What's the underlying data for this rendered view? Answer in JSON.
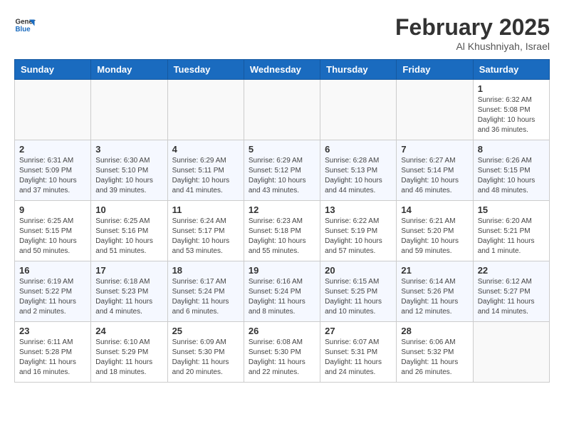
{
  "header": {
    "logo_line1": "General",
    "logo_line2": "Blue",
    "month": "February 2025",
    "location": "Al Khushniyah, Israel"
  },
  "weekdays": [
    "Sunday",
    "Monday",
    "Tuesday",
    "Wednesday",
    "Thursday",
    "Friday",
    "Saturday"
  ],
  "weeks": [
    [
      {
        "day": "",
        "info": ""
      },
      {
        "day": "",
        "info": ""
      },
      {
        "day": "",
        "info": ""
      },
      {
        "day": "",
        "info": ""
      },
      {
        "day": "",
        "info": ""
      },
      {
        "day": "",
        "info": ""
      },
      {
        "day": "1",
        "info": "Sunrise: 6:32 AM\nSunset: 5:08 PM\nDaylight: 10 hours\nand 36 minutes."
      }
    ],
    [
      {
        "day": "2",
        "info": "Sunrise: 6:31 AM\nSunset: 5:09 PM\nDaylight: 10 hours\nand 37 minutes."
      },
      {
        "day": "3",
        "info": "Sunrise: 6:30 AM\nSunset: 5:10 PM\nDaylight: 10 hours\nand 39 minutes."
      },
      {
        "day": "4",
        "info": "Sunrise: 6:29 AM\nSunset: 5:11 PM\nDaylight: 10 hours\nand 41 minutes."
      },
      {
        "day": "5",
        "info": "Sunrise: 6:29 AM\nSunset: 5:12 PM\nDaylight: 10 hours\nand 43 minutes."
      },
      {
        "day": "6",
        "info": "Sunrise: 6:28 AM\nSunset: 5:13 PM\nDaylight: 10 hours\nand 44 minutes."
      },
      {
        "day": "7",
        "info": "Sunrise: 6:27 AM\nSunset: 5:14 PM\nDaylight: 10 hours\nand 46 minutes."
      },
      {
        "day": "8",
        "info": "Sunrise: 6:26 AM\nSunset: 5:15 PM\nDaylight: 10 hours\nand 48 minutes."
      }
    ],
    [
      {
        "day": "9",
        "info": "Sunrise: 6:25 AM\nSunset: 5:15 PM\nDaylight: 10 hours\nand 50 minutes."
      },
      {
        "day": "10",
        "info": "Sunrise: 6:25 AM\nSunset: 5:16 PM\nDaylight: 10 hours\nand 51 minutes."
      },
      {
        "day": "11",
        "info": "Sunrise: 6:24 AM\nSunset: 5:17 PM\nDaylight: 10 hours\nand 53 minutes."
      },
      {
        "day": "12",
        "info": "Sunrise: 6:23 AM\nSunset: 5:18 PM\nDaylight: 10 hours\nand 55 minutes."
      },
      {
        "day": "13",
        "info": "Sunrise: 6:22 AM\nSunset: 5:19 PM\nDaylight: 10 hours\nand 57 minutes."
      },
      {
        "day": "14",
        "info": "Sunrise: 6:21 AM\nSunset: 5:20 PM\nDaylight: 10 hours\nand 59 minutes."
      },
      {
        "day": "15",
        "info": "Sunrise: 6:20 AM\nSunset: 5:21 PM\nDaylight: 11 hours\nand 1 minute."
      }
    ],
    [
      {
        "day": "16",
        "info": "Sunrise: 6:19 AM\nSunset: 5:22 PM\nDaylight: 11 hours\nand 2 minutes."
      },
      {
        "day": "17",
        "info": "Sunrise: 6:18 AM\nSunset: 5:23 PM\nDaylight: 11 hours\nand 4 minutes."
      },
      {
        "day": "18",
        "info": "Sunrise: 6:17 AM\nSunset: 5:24 PM\nDaylight: 11 hours\nand 6 minutes."
      },
      {
        "day": "19",
        "info": "Sunrise: 6:16 AM\nSunset: 5:24 PM\nDaylight: 11 hours\nand 8 minutes."
      },
      {
        "day": "20",
        "info": "Sunrise: 6:15 AM\nSunset: 5:25 PM\nDaylight: 11 hours\nand 10 minutes."
      },
      {
        "day": "21",
        "info": "Sunrise: 6:14 AM\nSunset: 5:26 PM\nDaylight: 11 hours\nand 12 minutes."
      },
      {
        "day": "22",
        "info": "Sunrise: 6:12 AM\nSunset: 5:27 PM\nDaylight: 11 hours\nand 14 minutes."
      }
    ],
    [
      {
        "day": "23",
        "info": "Sunrise: 6:11 AM\nSunset: 5:28 PM\nDaylight: 11 hours\nand 16 minutes."
      },
      {
        "day": "24",
        "info": "Sunrise: 6:10 AM\nSunset: 5:29 PM\nDaylight: 11 hours\nand 18 minutes."
      },
      {
        "day": "25",
        "info": "Sunrise: 6:09 AM\nSunset: 5:30 PM\nDaylight: 11 hours\nand 20 minutes."
      },
      {
        "day": "26",
        "info": "Sunrise: 6:08 AM\nSunset: 5:30 PM\nDaylight: 11 hours\nand 22 minutes."
      },
      {
        "day": "27",
        "info": "Sunrise: 6:07 AM\nSunset: 5:31 PM\nDaylight: 11 hours\nand 24 minutes."
      },
      {
        "day": "28",
        "info": "Sunrise: 6:06 AM\nSunset: 5:32 PM\nDaylight: 11 hours\nand 26 minutes."
      },
      {
        "day": "",
        "info": ""
      }
    ]
  ]
}
